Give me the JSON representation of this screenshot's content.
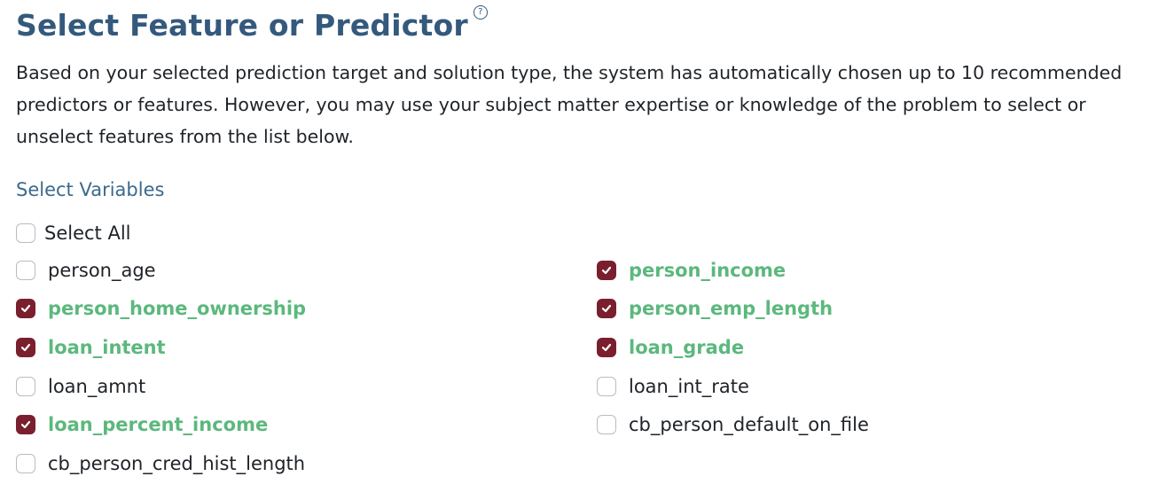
{
  "header": {
    "title": "Select Feature or Predictor",
    "help_icon": "question-circle-icon"
  },
  "description": "Based on your selected prediction target and solution type, the system has automatically chosen up to 10 recommended predictors or features. However, you may use your subject matter expertise or knowledge of the problem to select or unselect features from the list below.",
  "variables": {
    "section_label": "Select Variables",
    "select_all": {
      "label": "Select All",
      "checked": false
    },
    "features": [
      {
        "label": "person_age",
        "checked": false
      },
      {
        "label": "person_income",
        "checked": true
      },
      {
        "label": "person_home_ownership",
        "checked": true
      },
      {
        "label": "person_emp_length",
        "checked": true
      },
      {
        "label": "loan_intent",
        "checked": true
      },
      {
        "label": "loan_grade",
        "checked": true
      },
      {
        "label": "loan_amnt",
        "checked": false
      },
      {
        "label": "loan_int_rate",
        "checked": false
      },
      {
        "label": "loan_percent_income",
        "checked": true
      },
      {
        "label": "cb_person_default_on_file",
        "checked": false
      },
      {
        "label": "cb_person_cred_hist_length",
        "checked": false
      }
    ]
  },
  "colors": {
    "title": "#34597c",
    "section_label": "#3c6a8c",
    "checked_box": "#7a1f2e",
    "selected_text": "#5cb87d",
    "body_text": "#1f2328"
  }
}
